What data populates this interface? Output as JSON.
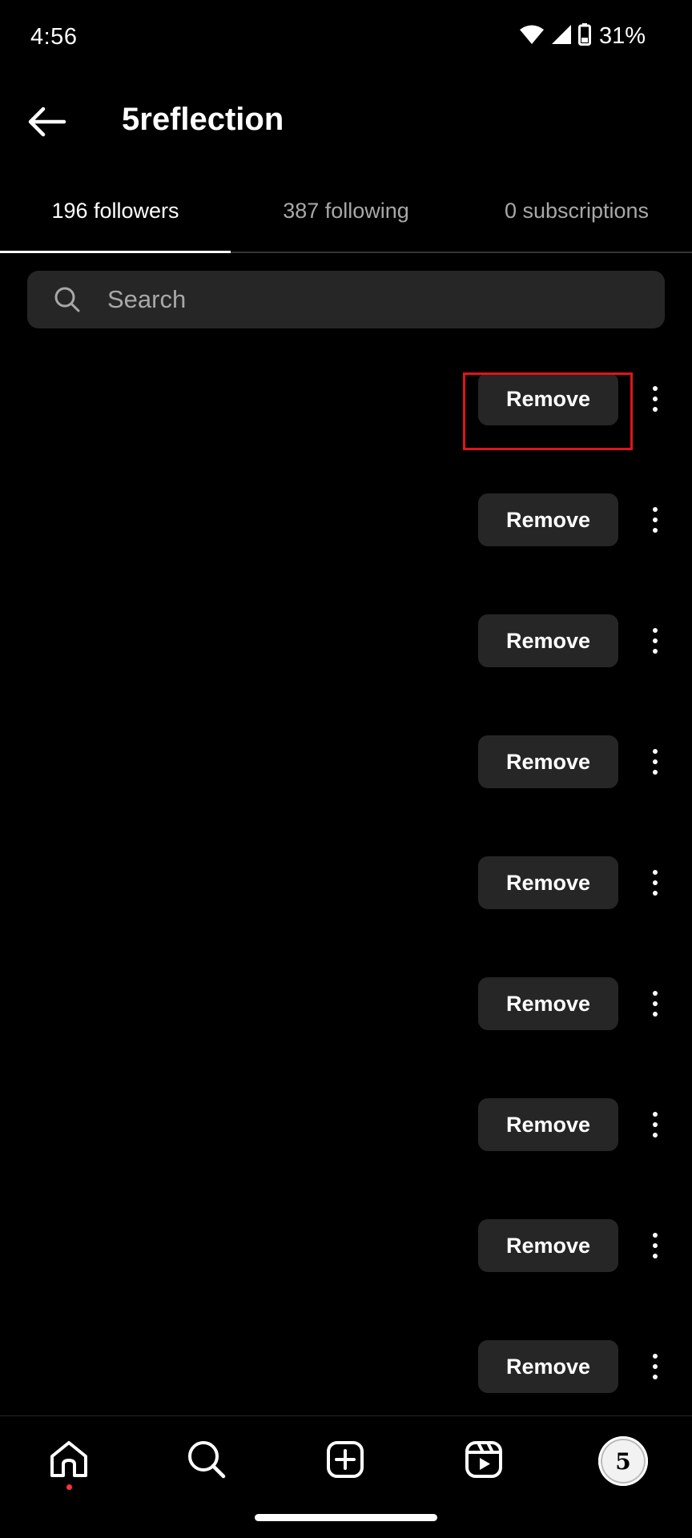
{
  "status_bar": {
    "time": "4:56",
    "battery": "31%",
    "icons": [
      "wifi-icon",
      "cellular-signal-icon",
      "battery-icon"
    ]
  },
  "header": {
    "back_icon": "arrow-left-icon",
    "title": "5reflection"
  },
  "tabs": [
    {
      "label": "196 followers",
      "active": true
    },
    {
      "label": "387 following",
      "active": false
    },
    {
      "label": "0 subscriptions",
      "active": false
    }
  ],
  "search": {
    "placeholder": "Search",
    "value": ""
  },
  "followers": [
    {
      "remove_label": "Remove",
      "highlighted": true
    },
    {
      "remove_label": "Remove",
      "highlighted": false
    },
    {
      "remove_label": "Remove",
      "highlighted": false
    },
    {
      "remove_label": "Remove",
      "highlighted": false
    },
    {
      "remove_label": "Remove",
      "highlighted": false
    },
    {
      "remove_label": "Remove",
      "highlighted": false
    },
    {
      "remove_label": "Remove",
      "highlighted": false
    },
    {
      "remove_label": "Remove",
      "highlighted": false
    },
    {
      "remove_label": "Remove",
      "highlighted": false
    }
  ],
  "bottom_nav": {
    "items": [
      "home-icon",
      "search-icon",
      "create-icon",
      "reels-icon",
      "profile-avatar"
    ],
    "profile_initial": "5"
  },
  "colors": {
    "background": "#000000",
    "button_bg": "#262626",
    "highlight": "#e0141b",
    "notification": "#ff3040"
  }
}
